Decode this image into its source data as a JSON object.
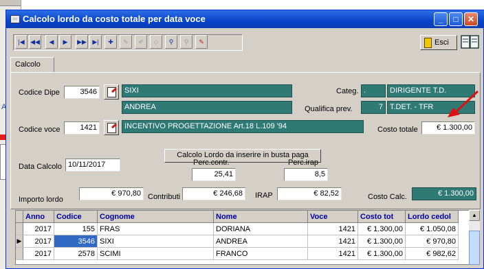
{
  "window": {
    "title": "Calcolo lordo da costo totale per data voce",
    "title_icon": "app-icon"
  },
  "background": {
    "side_label": "A"
  },
  "toolbar": {
    "buttons": [
      "first-record",
      "prev-page",
      "prev-record",
      "next-record",
      "next-page",
      "last-record",
      "new-record",
      "edit-record",
      "copy-record",
      "delete-record",
      "search",
      "filter",
      "clear-filter"
    ],
    "esci_label": "Esci"
  },
  "tab": {
    "label": "Calcolo"
  },
  "form": {
    "codice_dipe_label": "Codice Dipe",
    "codice_dipe_value": "3546",
    "cognome": "SIXI",
    "nome": "ANDREA",
    "categ_label": "Categ.",
    "categ_value": ".",
    "categ_desc": "DIRIGENTE T.D.",
    "qualifica_label": "Qualifica prev.",
    "qualifica_value": "7",
    "qualifica_desc": "T.DET. - TFR",
    "codice_voce_label": "Codice voce",
    "codice_voce_value": "1421",
    "voce_desc": "INCENTIVO PROGETTAZIONE Art.18 L.109 '94",
    "costo_totale_label": "Costo totale",
    "costo_totale_value": "€ 1.300,00",
    "calc_button": "Calcolo Lordo da inserire in busta paga",
    "data_calcolo_label": "Data Calcolo",
    "data_calcolo_value": "10/11/2017",
    "perc_contr_label": "Perc.contr.",
    "perc_contr_value": "25,41",
    "perc_irap_label": "Perc.irap",
    "perc_irap_value": "8,5",
    "importo_lordo_label": "Importo lordo",
    "importo_lordo_value": "€ 970,80",
    "contributi_label": "Contributi",
    "contributi_value": "€ 246,68",
    "irap_label": "IRAP",
    "irap_value": "€ 82,52",
    "costo_calc_label": "Costo Calc.",
    "costo_calc_value": "€ 1.300,00"
  },
  "grid": {
    "columns": [
      "Anno",
      "Codice",
      "Cognome",
      "Nome",
      "Voce",
      "Costo tot",
      "Lordo cedol"
    ],
    "rows": [
      {
        "anno": "2017",
        "codice": "155",
        "cognome": "FRAS",
        "nome": "DORIANA",
        "voce": "1421",
        "costo": "€ 1.300,00",
        "lordo": "€ 1.050,08"
      },
      {
        "anno": "2017",
        "codice": "3546",
        "cognome": "SIXI",
        "nome": "ANDREA",
        "voce": "1421",
        "costo": "€ 1.300,00",
        "lordo": "€ 970,80"
      },
      {
        "anno": "2017",
        "codice": "2578",
        "cognome": "SCIMI",
        "nome": "FRANCO",
        "voce": "1421",
        "costo": "€ 1.300,00",
        "lordo": "€ 982,62"
      }
    ]
  },
  "colors": {
    "teal": "#2f7a75",
    "title_blue": "#0a44c8",
    "selection": "#316ac5",
    "annotation_red": "#e01010"
  }
}
